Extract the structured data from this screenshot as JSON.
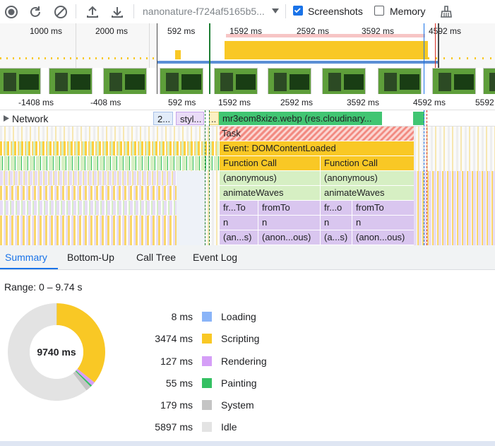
{
  "toolbar": {
    "profile_select": "nanonature-f724af5165b5...",
    "screenshots_label": "Screenshots",
    "screenshots_checked": true,
    "memory_label": "Memory",
    "memory_checked": false
  },
  "overview": {
    "ruler_labels": [
      "1000 ms",
      "2000 ms",
      "592 ms",
      "1592 ms",
      "2592 ms",
      "3592 ms",
      "4592 ms"
    ]
  },
  "timeline": {
    "ruler_labels": [
      "-1408 ms",
      "-408 ms",
      "592 ms",
      "1592 ms",
      "2592 ms",
      "3592 ms",
      "4592 ms",
      "5592"
    ],
    "network_label": "Network",
    "network_items": [
      "2...",
      "styl...",
      "..",
      "mr3eom8xize.webp (res.cloudinary..."
    ]
  },
  "flame": {
    "task": "Task",
    "event": "Event: DOMContentLoaded",
    "function_call_1": "Function Call",
    "function_call_2": "Function Call",
    "anon_1": "(anonymous)",
    "anon_2": "(anonymous)",
    "animate_1": "animateWaves",
    "animate_2": "animateWaves",
    "fr_1": "fr...To",
    "fromTo_1": "fromTo",
    "fr_2": "fr...o",
    "fromTo_2": "fromTo",
    "n_1": "n",
    "n_2": "n",
    "n_3": "n",
    "n_4": "n",
    "ans_1": "(an...s)",
    "anonous_1": "(anon...ous)",
    "as_2": "(a...s)",
    "anonous_2": "(anon...ous)"
  },
  "tabs": [
    "Summary",
    "Bottom-Up",
    "Call Tree",
    "Event Log"
  ],
  "summary": {
    "range": "Range: 0 – 9.74 s",
    "total": "9740 ms",
    "items": [
      {
        "value": "8 ms",
        "label": "Loading",
        "color": "#8ab4f8",
        "ms": 8
      },
      {
        "value": "3474 ms",
        "label": "Scripting",
        "color": "#f9c825",
        "ms": 3474
      },
      {
        "value": "127 ms",
        "label": "Rendering",
        "color": "#d59ef7",
        "ms": 127
      },
      {
        "value": "55 ms",
        "label": "Painting",
        "color": "#34c062",
        "ms": 55
      },
      {
        "value": "179 ms",
        "label": "System",
        "color": "#c4c4c4",
        "ms": 179
      },
      {
        "value": "5897 ms",
        "label": "Idle",
        "color": "#e3e3e3",
        "ms": 5897
      }
    ]
  },
  "colors": {
    "accent": "#1a73e8",
    "scripting": "#f9c825",
    "task_red": "#f28b82",
    "function_call": "#fccf3e",
    "js_green": "#d6efc3",
    "js_purple": "#d9c6ef",
    "network_green": "#41c572"
  }
}
